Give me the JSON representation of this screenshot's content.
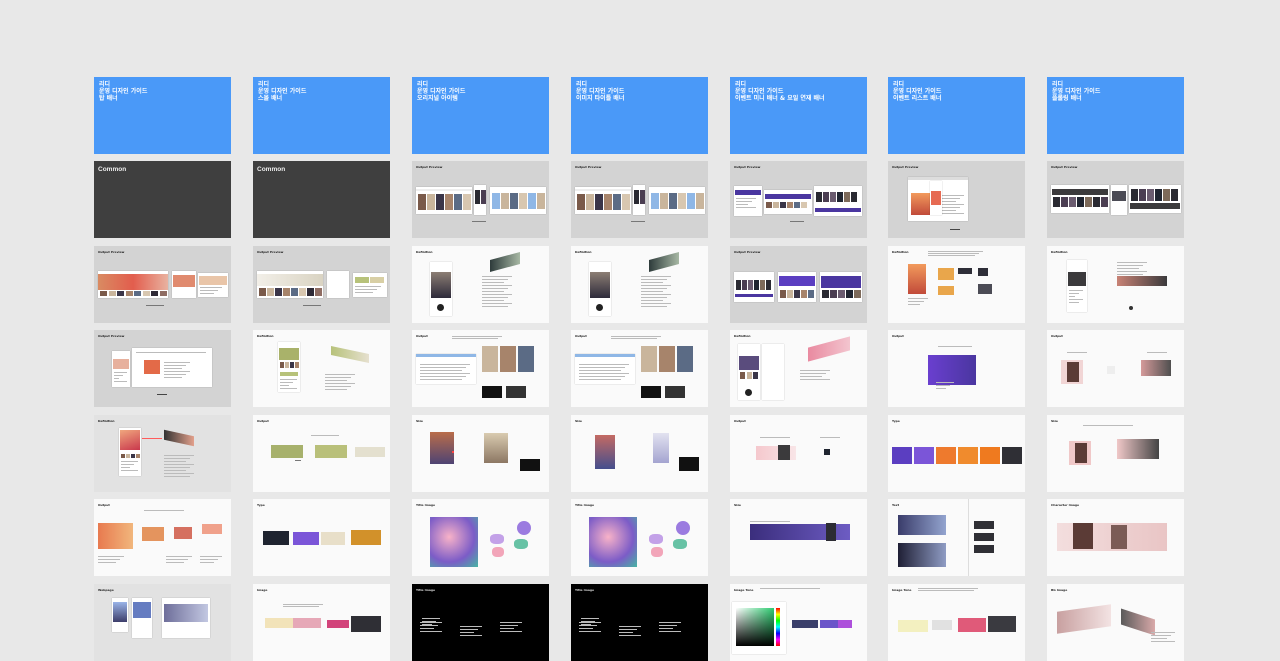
{
  "columns": [
    {
      "title_lines": [
        "리디",
        "운영 디자인 가이드",
        "탑 배너"
      ],
      "slides": [
        {
          "kind": "common",
          "label": "Common"
        },
        {
          "kind": "preview-wide",
          "label": "Output Preview"
        },
        {
          "kind": "preview-browser",
          "label": "Output Preview"
        },
        {
          "kind": "definition-phone",
          "label": "Definition"
        },
        {
          "kind": "output-banners-warm",
          "label": "Output"
        },
        {
          "kind": "webpage-screens",
          "label": "Webpage"
        }
      ]
    },
    {
      "title_lines": [
        "리디",
        "운영 디자인 가이드",
        "스몰 배너"
      ],
      "slides": [
        {
          "kind": "common",
          "label": "Common"
        },
        {
          "kind": "preview-wide-light",
          "label": "Output Preview"
        },
        {
          "kind": "definition-olive",
          "label": "Definition"
        },
        {
          "kind": "output-olive",
          "label": "Output"
        },
        {
          "kind": "types-row",
          "label": "Type"
        },
        {
          "kind": "image-row",
          "label": "Image"
        }
      ]
    },
    {
      "title_lines": [
        "리디",
        "운영 디자인 가이드",
        "오리지널 아이템"
      ],
      "slides": [
        {
          "kind": "preview-covers",
          "label": "Output Preview"
        },
        {
          "kind": "definition-phone-dark",
          "label": "Definition"
        },
        {
          "kind": "output-browser-covers",
          "label": "Output"
        },
        {
          "kind": "size-covers",
          "label": "Size"
        },
        {
          "kind": "title-image",
          "label": "Title Image"
        },
        {
          "kind": "title-image-black",
          "label": "Title Image"
        }
      ]
    },
    {
      "title_lines": [
        "리디",
        "운영 디자인 가이드",
        "이미지 타이틀 배너"
      ],
      "slides": [
        {
          "kind": "preview-covers",
          "label": "Output Preview"
        },
        {
          "kind": "definition-phone-dark",
          "label": "Definition"
        },
        {
          "kind": "output-browser-covers",
          "label": "Output"
        },
        {
          "kind": "size-covers-b",
          "label": "Size"
        },
        {
          "kind": "title-image",
          "label": "Title Image"
        },
        {
          "kind": "title-image-black",
          "label": "Title Image"
        }
      ]
    },
    {
      "title_lines": [
        "리디",
        "운영 디자인 가이드",
        "이벤트 미니 배너 & 요일 연재 배너"
      ],
      "slides": [
        {
          "kind": "preview-purple",
          "label": "Output Preview"
        },
        {
          "kind": "preview-purple-strip",
          "label": "Output Preview"
        },
        {
          "kind": "definition-phone-pink",
          "label": "Definition"
        },
        {
          "kind": "output-pink",
          "label": "Output"
        },
        {
          "kind": "size-purple",
          "label": "Size"
        },
        {
          "kind": "image-tone",
          "label": "Image Tone"
        }
      ]
    },
    {
      "title_lines": [
        "리디",
        "운영 디자인 가이드",
        "이벤트 리스트 배너"
      ],
      "slides": [
        {
          "kind": "preview-browser-b",
          "label": "Output Preview"
        },
        {
          "kind": "definition-orange",
          "label": "Definition"
        },
        {
          "kind": "output-purple-single",
          "label": "Output"
        },
        {
          "kind": "types-colors",
          "label": "Type"
        },
        {
          "kind": "text-blue",
          "label": "Text"
        },
        {
          "kind": "image-tone-b",
          "label": "Image Tone"
        }
      ]
    },
    {
      "title_lines": [
        "리디",
        "운영 디자인 가이드",
        "플롤링 배너"
      ],
      "slides": [
        {
          "kind": "preview-dark-strip",
          "label": "Output Preview"
        },
        {
          "kind": "definition-phone-c",
          "label": "Definition"
        },
        {
          "kind": "output-people",
          "label": "Output"
        },
        {
          "kind": "size-people",
          "label": "Size"
        },
        {
          "kind": "character-image",
          "label": "Character Image"
        },
        {
          "kind": "bg-image",
          "label": "BG Image"
        }
      ]
    }
  ]
}
